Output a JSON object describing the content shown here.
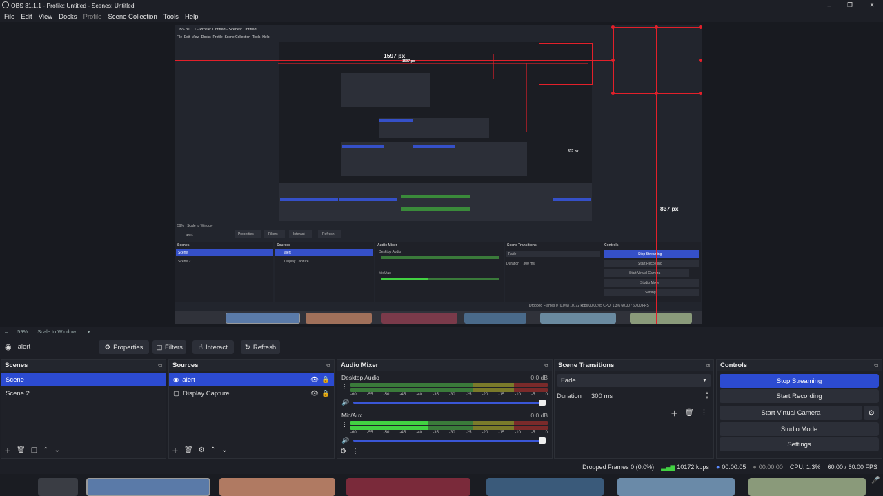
{
  "window": {
    "title": "OBS 31.1.1 - Profile: Untitled - Scenes: Untitled"
  },
  "menu": {
    "items": [
      "File",
      "Edit",
      "View",
      "Docks",
      "Profile",
      "Scene Collection",
      "Tools",
      "Help"
    ]
  },
  "preview": {
    "measure_h": "1597 px",
    "measure_h_small": "1597 px",
    "measure_v": "837 px",
    "measure_v_small": "837 px",
    "nested": {
      "title": "OBS 31.1.1 - Profile: Untitled - Scenes: Untitled",
      "menu": [
        "File",
        "Edit",
        "View",
        "Docks",
        "Profile",
        "Scene Collection",
        "Tools",
        "Help"
      ],
      "zoom": "59%",
      "scale": "Scale to Window",
      "source": "alert",
      "buttons": [
        "Properties",
        "Filters",
        "Interact",
        "Refresh"
      ],
      "docks": [
        "Scenes",
        "Sources",
        "Audio Mixer",
        "Scene Transitions",
        "Controls"
      ],
      "scenes": [
        "Scene",
        "Scene 2"
      ],
      "sources": [
        "alert",
        "Display Capture"
      ],
      "mixer": [
        "Desktop Audio",
        "Mic/Aux"
      ],
      "transition": "Fade",
      "duration_label": "Duration",
      "duration": "300 ms",
      "controls": [
        "Stop Streaming",
        "Start Recording",
        "Start Virtual Camera",
        "Studio Mode",
        "Settings"
      ],
      "status": "Dropped Frames 0 (0.0%)   10172 kbps   00:00:05   CPU: 1.3%   60.00 / 60.00 FPS"
    }
  },
  "zoombar": {
    "minus": "–",
    "zoom": "59%",
    "scale_mode": "Scale to Window"
  },
  "source_toolbar": {
    "name": "alert",
    "properties": "Properties",
    "filters": "Filters",
    "interact": "Interact",
    "refresh": "Refresh"
  },
  "scenes": {
    "title": "Scenes",
    "items": [
      "Scene",
      "Scene 2"
    ]
  },
  "sources": {
    "title": "Sources",
    "items": [
      "alert",
      "Display Capture"
    ]
  },
  "mixer": {
    "title": "Audio Mixer",
    "channels": [
      {
        "name": "Desktop Audio",
        "db": "0.0 dB",
        "level": 0.0
      },
      {
        "name": "Mic/Aux",
        "db": "0.0 dB",
        "level": 0.39
      }
    ],
    "scale": [
      "-60",
      "-55",
      "-50",
      "-45",
      "-40",
      "-35",
      "-30",
      "-25",
      "-20",
      "-15",
      "-10",
      "-5",
      "0"
    ]
  },
  "transitions": {
    "title": "Scene Transitions",
    "selected": "Fade",
    "duration_label": "Duration",
    "duration": "300 ms"
  },
  "controls": {
    "title": "Controls",
    "stop_streaming": "Stop Streaming",
    "start_recording": "Start Recording",
    "start_virtual_camera": "Start Virtual Camera",
    "studio_mode": "Studio Mode",
    "settings": "Settings"
  },
  "status": {
    "dropped": "Dropped Frames 0 (0.0%)",
    "kbps": "10172 kbps",
    "stream_time": "00:00:05",
    "rec_time": "00:00:00",
    "cpu": "CPU: 1.3%",
    "fps": "60.00 / 60.00 FPS"
  },
  "colors": {
    "accent": "#2c4bd1",
    "measure": "#e3202a",
    "meter_green": "#42d142"
  }
}
